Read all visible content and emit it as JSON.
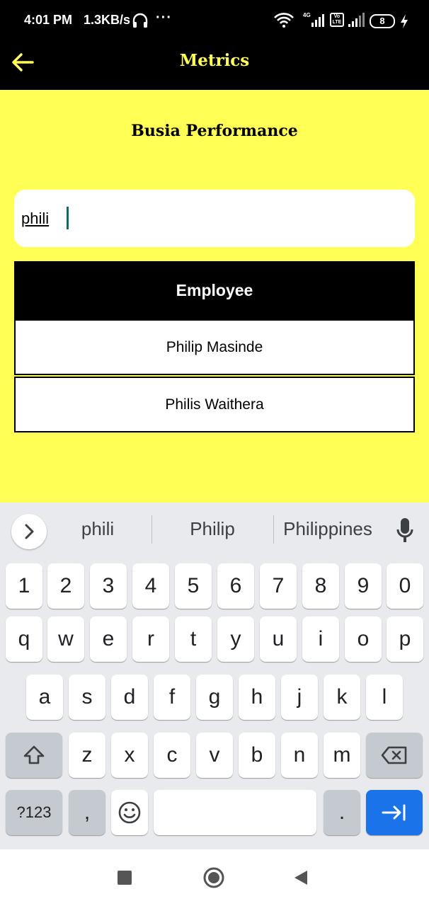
{
  "status_bar": {
    "time": "4:01 PM",
    "speed": "1.3KB/s",
    "dots": "···",
    "network_small": "4G",
    "volte": "Vo LTE",
    "battery": "8"
  },
  "app_bar": {
    "title": "Metrics",
    "back_icon": "arrow-left-icon",
    "accent_color": "#ffff55",
    "background": "#000000"
  },
  "page": {
    "heading": "Busia Performance",
    "background": "#ffff55"
  },
  "search": {
    "value": "phili"
  },
  "table": {
    "header": "Employee",
    "rows": [
      "Philip Masinde",
      "Philis Waithera"
    ]
  },
  "keyboard": {
    "suggestions": [
      "phili",
      "Philip",
      "Philippines"
    ],
    "row1": [
      "1",
      "2",
      "3",
      "4",
      "5",
      "6",
      "7",
      "8",
      "9",
      "0"
    ],
    "row2": [
      "q",
      "w",
      "e",
      "r",
      "t",
      "y",
      "u",
      "i",
      "o",
      "p"
    ],
    "row3": [
      "a",
      "s",
      "d",
      "f",
      "g",
      "h",
      "j",
      "k",
      "l"
    ],
    "row4": [
      "z",
      "x",
      "c",
      "v",
      "b",
      "n",
      "m"
    ],
    "symbols_label": "?123",
    "comma": ",",
    "period": ".",
    "emoji_icon": "smiley-icon",
    "enter_icon": "tab-arrow-icon",
    "shift_icon": "shift-icon",
    "backspace_icon": "backspace-icon",
    "mic_icon": "microphone-icon",
    "enter_color": "#1a73e8"
  }
}
